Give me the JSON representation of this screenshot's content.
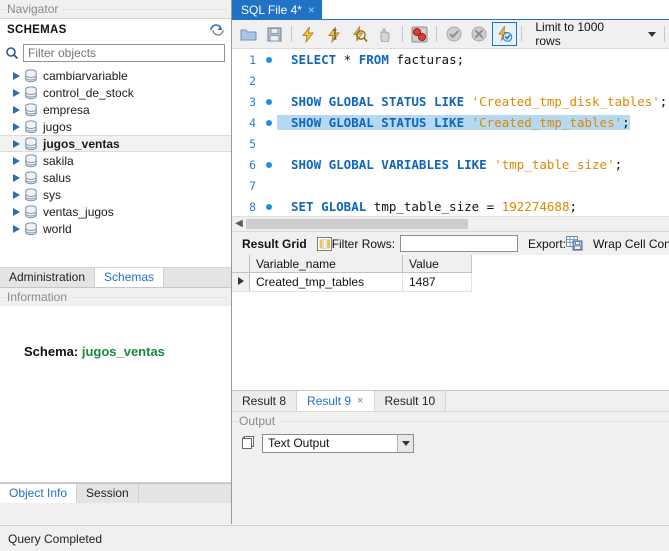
{
  "navigator": {
    "caption": "Navigator",
    "schemas_header": "SCHEMAS",
    "refresh_icon": "refresh-icon",
    "search_icon": "search-icon",
    "filter_placeholder": "Filter objects",
    "filter_value": "",
    "schemas": [
      {
        "name": "cambiarvariable",
        "selected": false
      },
      {
        "name": "control_de_stock",
        "selected": false
      },
      {
        "name": "empresa",
        "selected": false
      },
      {
        "name": "jugos",
        "selected": false
      },
      {
        "name": "jugos_ventas",
        "selected": true
      },
      {
        "name": "sakila",
        "selected": false
      },
      {
        "name": "salus",
        "selected": false
      },
      {
        "name": "sys",
        "selected": false
      },
      {
        "name": "ventas_jugos",
        "selected": false
      },
      {
        "name": "world",
        "selected": false
      }
    ],
    "panel_tabs": [
      {
        "label": "Administration",
        "active": false
      },
      {
        "label": "Schemas",
        "active": true
      }
    ],
    "information_caption": "Information",
    "info_label": "Schema:",
    "info_value": "jugos_ventas",
    "bottom_tabs": [
      {
        "label": "Object Info",
        "active": true
      },
      {
        "label": "Session",
        "active": false
      }
    ]
  },
  "editor": {
    "file_tab": {
      "label": "SQL File 4*",
      "close": "×"
    },
    "toolbar": {
      "buttons": [
        {
          "name": "open-file-icon",
          "active": false
        },
        {
          "name": "save-file-icon",
          "active": false
        },
        {
          "name": "execute-statement-icon",
          "active": false
        },
        {
          "name": "execute-current-statement-icon",
          "active": false
        },
        {
          "name": "explain-query-icon",
          "active": false
        },
        {
          "name": "stop-execution-icon",
          "active": false
        },
        {
          "name": "toggle-breakpoint-icon",
          "active": false
        },
        {
          "name": "commit-icon",
          "active": false
        },
        {
          "name": "rollback-icon",
          "active": false
        },
        {
          "name": "auto-commit-icon",
          "active": true
        }
      ],
      "limit_label": "Limit to 1000 rows",
      "limit_caret": "chevron-down-icon"
    },
    "lines": [
      {
        "num": "1",
        "dot": true,
        "tokens": [
          {
            "t": "SELECT",
            "c": "kw"
          },
          {
            "t": " ",
            "c": "pln"
          },
          {
            "t": "*",
            "c": "op"
          },
          {
            "t": " ",
            "c": "pln"
          },
          {
            "t": "FROM",
            "c": "kw"
          },
          {
            "t": " ",
            "c": "pln"
          },
          {
            "t": "facturas",
            "c": "pln"
          },
          {
            "t": ";",
            "c": "pln"
          }
        ]
      },
      {
        "num": "2",
        "dot": false,
        "tokens": []
      },
      {
        "num": "3",
        "dot": true,
        "tokens": [
          {
            "t": "SHOW GLOBAL STATUS LIKE",
            "c": "kw"
          },
          {
            "t": " ",
            "c": "pln"
          },
          {
            "t": "'Created_tmp_disk_tables'",
            "c": "str"
          },
          {
            "t": ";",
            "c": "pln"
          }
        ]
      },
      {
        "num": "4",
        "dot": true,
        "selected": true,
        "tokens": [
          {
            "t": "SHOW GLOBAL STATUS LIKE",
            "c": "kw"
          },
          {
            "t": " ",
            "c": "pln"
          },
          {
            "t": "'Created_tmp_tables'",
            "c": "str"
          },
          {
            "t": ";",
            "c": "pln"
          }
        ]
      },
      {
        "num": "5",
        "dot": false,
        "tokens": []
      },
      {
        "num": "6",
        "dot": true,
        "tokens": [
          {
            "t": "SHOW GLOBAL VARIABLES LIKE",
            "c": "kw"
          },
          {
            "t": " ",
            "c": "pln"
          },
          {
            "t": "'tmp_table_size'",
            "c": "str"
          },
          {
            "t": ";",
            "c": "pln"
          }
        ]
      },
      {
        "num": "7",
        "dot": false,
        "tokens": []
      },
      {
        "num": "8",
        "dot": true,
        "tokens": [
          {
            "t": "SET GLOBAL",
            "c": "kw"
          },
          {
            "t": " ",
            "c": "pln"
          },
          {
            "t": "tmp_table_size",
            "c": "pln"
          },
          {
            "t": " = ",
            "c": "op"
          },
          {
            "t": "192274688",
            "c": "num"
          },
          {
            "t": ";",
            "c": "pln"
          }
        ]
      }
    ]
  },
  "grid_toolbar": {
    "result_grid_label": "Result Grid",
    "grid_view_icon": "grid-view-icon",
    "filter_rows_label": "Filter Rows:",
    "filter_rows_value": "",
    "export_label": "Export:",
    "export_icon": "export-icon",
    "wrap_cell_label": "Wrap Cell Content:"
  },
  "result_grid": {
    "columns": [
      "Variable_name",
      "Value"
    ],
    "rows": [
      {
        "marker": "row-marker-icon",
        "Variable_name": "Created_tmp_tables",
        "Value": "1487"
      }
    ]
  },
  "result_tabs": [
    {
      "label": "Result 8",
      "active": false,
      "closable": false
    },
    {
      "label": "Result 9",
      "active": true,
      "closable": true,
      "close": "×"
    },
    {
      "label": "Result 10",
      "active": false,
      "closable": false
    }
  ],
  "output": {
    "caption": "Output",
    "icon": "output-pane-icon",
    "selected_mode": "Text Output",
    "caret": "chevron-down-icon"
  },
  "status_bar": {
    "message": "Query Completed"
  },
  "colors": {
    "accent": "#1f72c4",
    "keyword": "#1166bb",
    "string": "#dd8800",
    "selection": "#b5d9f2",
    "schema_value": "#1a8a3c"
  }
}
